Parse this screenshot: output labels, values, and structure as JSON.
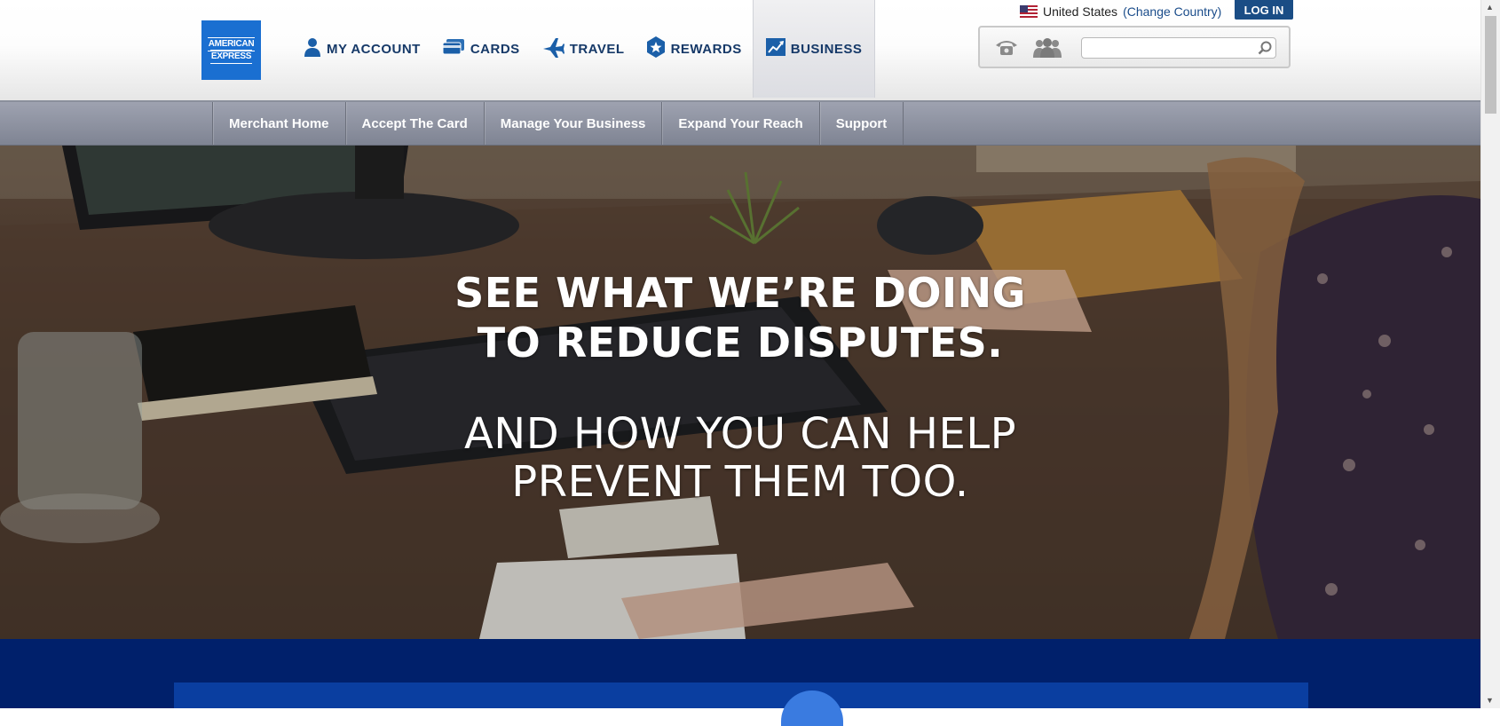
{
  "brand": {
    "logo_line1": "AMERICAN",
    "logo_line2": "EXPRESS",
    "logo_color": "#1a6fd1"
  },
  "main_nav": [
    {
      "label": "MY ACCOUNT",
      "icon": "user-icon"
    },
    {
      "label": "CARDS",
      "icon": "cards-icon"
    },
    {
      "label": "TRAVEL",
      "icon": "plane-icon"
    },
    {
      "label": "REWARDS",
      "icon": "star-badge-icon"
    },
    {
      "label": "BUSINESS",
      "icon": "chart-icon",
      "active": true
    }
  ],
  "country": {
    "name": "United States",
    "change_label": "(Change Country)",
    "flag_icon": "us-flag-icon"
  },
  "login_label": "LOG IN",
  "tools": {
    "phone_icon": "phone-icon",
    "people_icon": "people-icon",
    "search_placeholder": "",
    "search_icon": "search-icon"
  },
  "sub_nav": [
    "Merchant Home",
    "Accept The Card",
    "Manage Your Business",
    "Expand Your Reach",
    "Support"
  ],
  "hero": {
    "headline_line1": "SEE WHAT WE’RE DOING",
    "headline_line2": "TO REDUCE DISPUTES.",
    "subline_line1": "AND HOW YOU CAN HELP",
    "subline_line2": "PREVENT THEM TOO."
  },
  "colors": {
    "nav_text": "#163968",
    "login_bg": "#1a4d85",
    "band_bg": "#00206b"
  }
}
